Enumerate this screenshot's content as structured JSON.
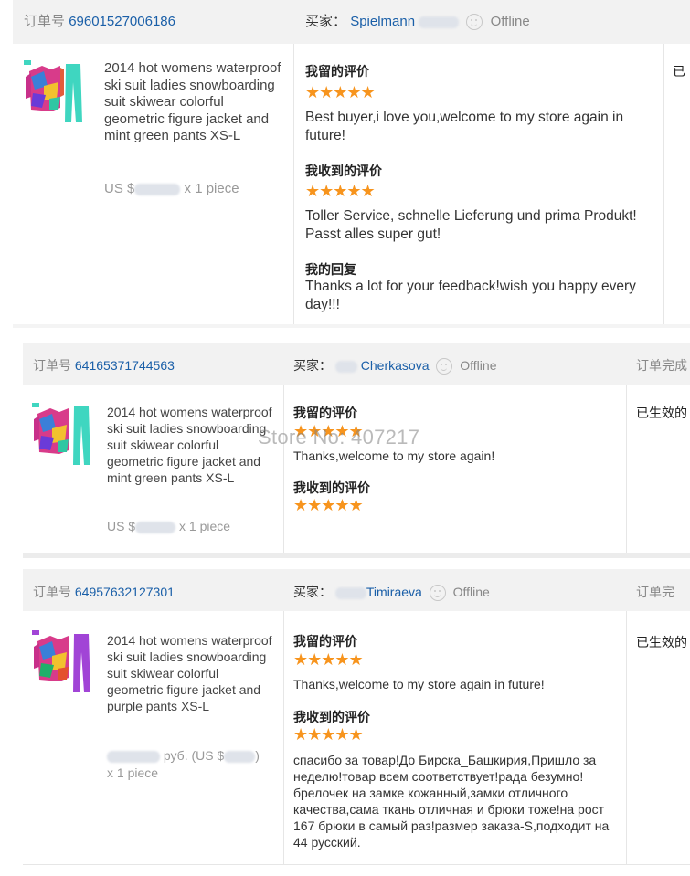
{
  "labels": {
    "order_no": "订单号",
    "buyer": "买家：",
    "left_review": "我留的评价",
    "received_review": "我收到的评价",
    "my_reply": "我的回复",
    "order_complete": "订单完成",
    "effective": "已生效的",
    "stars": "★★★★★"
  },
  "watermark": "Store No: 407217",
  "orders": [
    {
      "order_id": "69601527006186",
      "buyer_name": "Spielmann",
      "status": "Offline",
      "product_title": "2014 hot womens waterproof ski suit ladies snowboarding suit skiwear colorful geometric figure jacket and mint green pants XS-L",
      "price_prefix": "US $",
      "quantity": "x 1 piece",
      "left_review": "Best buyer,i love you,welcome to my store again in future!",
      "received_review": "Toller Service, schnelle Lieferung und prima Produkt! Passt alles super gut!",
      "reply": "Thanks a lot for your feedback!wish you happy every day!!!",
      "right_col": "已"
    },
    {
      "order_id": "64165371744563",
      "buyer_name": "Cherkasova",
      "status": "Offline",
      "product_title": "2014 hot womens waterproof ski suit ladies snowboarding suit skiwear colorful geometric figure jacket and mint green pants XS-L",
      "price_prefix": "US $",
      "quantity": "x 1 piece",
      "left_review": "Thanks,welcome to my store again!",
      "right_header": "订单完成",
      "right_col": "已生效的"
    },
    {
      "order_id": "64957632127301",
      "buyer_name": "Timiraeva",
      "status": "Offline",
      "product_title": "2014 hot womens waterproof ski suit ladies snowboarding suit skiwear colorful geometric figure jacket and purple pants XS-L",
      "price_prefix": "руб. (US $",
      "price_suffix": ")",
      "quantity": "x 1 piece",
      "left_review": "Thanks,welcome to my store again in future!",
      "received_review": "спасибо за товар!До Бирска_Башкирия,Пришло за неделю!товар всем соответствует!рада безумно!брелочек на замке кожанный,замки отличного качества,сама ткань отличная и брюки тоже!на рост 167 брюки в самый раз!размер заказа-S,подходит на 44 русский.",
      "right_header": "订单完",
      "right_col": "已生效的"
    }
  ],
  "colors": {
    "link": "#1a5fa8",
    "star": "#f7941d",
    "header_bg": "#f2f2f2"
  },
  "icons": [
    "offline-face-icon",
    "star-rating-icon",
    "product-thumbnail"
  ]
}
